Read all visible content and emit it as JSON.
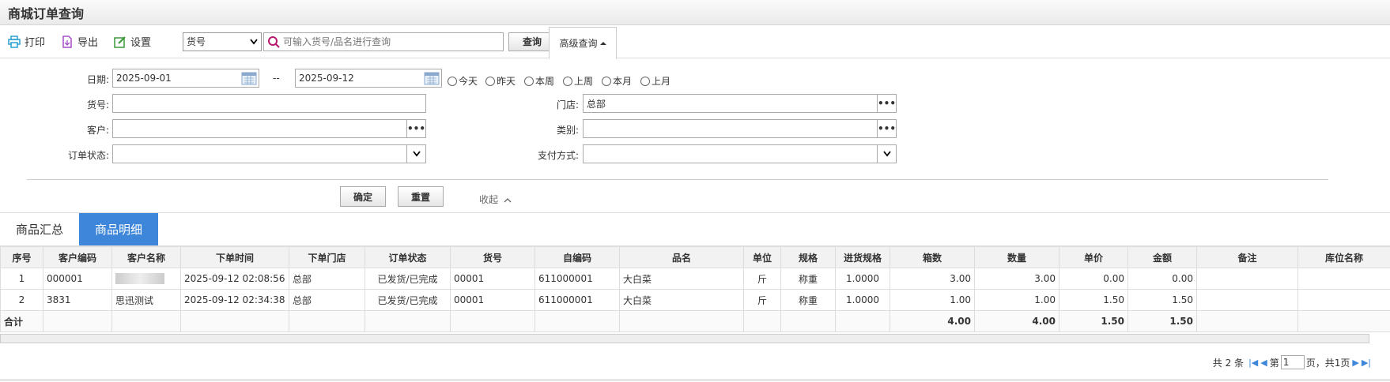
{
  "title": "商城订单查询",
  "toolbar": {
    "print": "打印",
    "export": "导出",
    "settings": "设置",
    "field_select": "货号",
    "search_placeholder": "可输入货号/品名进行查询",
    "query": "查询",
    "advanced": "高级查询"
  },
  "form": {
    "date_label": "日期:",
    "date_from": "2025-09-01",
    "date_sep": "--",
    "date_to": "2025-09-12",
    "quick": [
      "今天",
      "昨天",
      "本周",
      "上周",
      "本月",
      "上月"
    ],
    "sku_label": "货号:",
    "store_label": "门店:",
    "store_value": "总部",
    "customer_label": "客户:",
    "category_label": "类别:",
    "status_label": "订单状态:",
    "pay_label": "支付方式:",
    "confirm": "确定",
    "reset": "重置",
    "collapse": "收起"
  },
  "tabs": [
    "商品汇总",
    "商品明细"
  ],
  "table": {
    "headers": [
      "序号",
      "客户编码",
      "客户名称",
      "下单时间",
      "下单门店",
      "订单状态",
      "货号",
      "自编码",
      "品名",
      "单位",
      "规格",
      "进货规格",
      "箱数",
      "数量",
      "单价",
      "金额",
      "备注",
      "库位名称"
    ],
    "rows": [
      [
        "1",
        "000001",
        "",
        "2025-09-12 02:08:56",
        "总部",
        "已发货/已完成",
        "00001",
        "611000001",
        "大白菜",
        "斤",
        "称重",
        "1.0000",
        "3.00",
        "3.00",
        "0.00",
        "0.00",
        "",
        ""
      ],
      [
        "2",
        "3831",
        "思迅测试",
        "2025-09-12 02:34:38",
        "总部",
        "已发货/已完成",
        "00001",
        "611000001",
        "大白菜",
        "斤",
        "称重",
        "1.0000",
        "1.00",
        "1.00",
        "1.50",
        "1.50",
        "",
        ""
      ]
    ],
    "sum": [
      "合计",
      "",
      "",
      "",
      "",
      "",
      "",
      "",
      "",
      "",
      "",
      "",
      "4.00",
      "4.00",
      "1.50",
      "1.50",
      "",
      ""
    ]
  },
  "pager": {
    "total": "共 2 条",
    "page_prefix": "第",
    "page": "1",
    "page_suffix": "页，共1页"
  },
  "colors": {
    "accent": "#3d86d9"
  }
}
